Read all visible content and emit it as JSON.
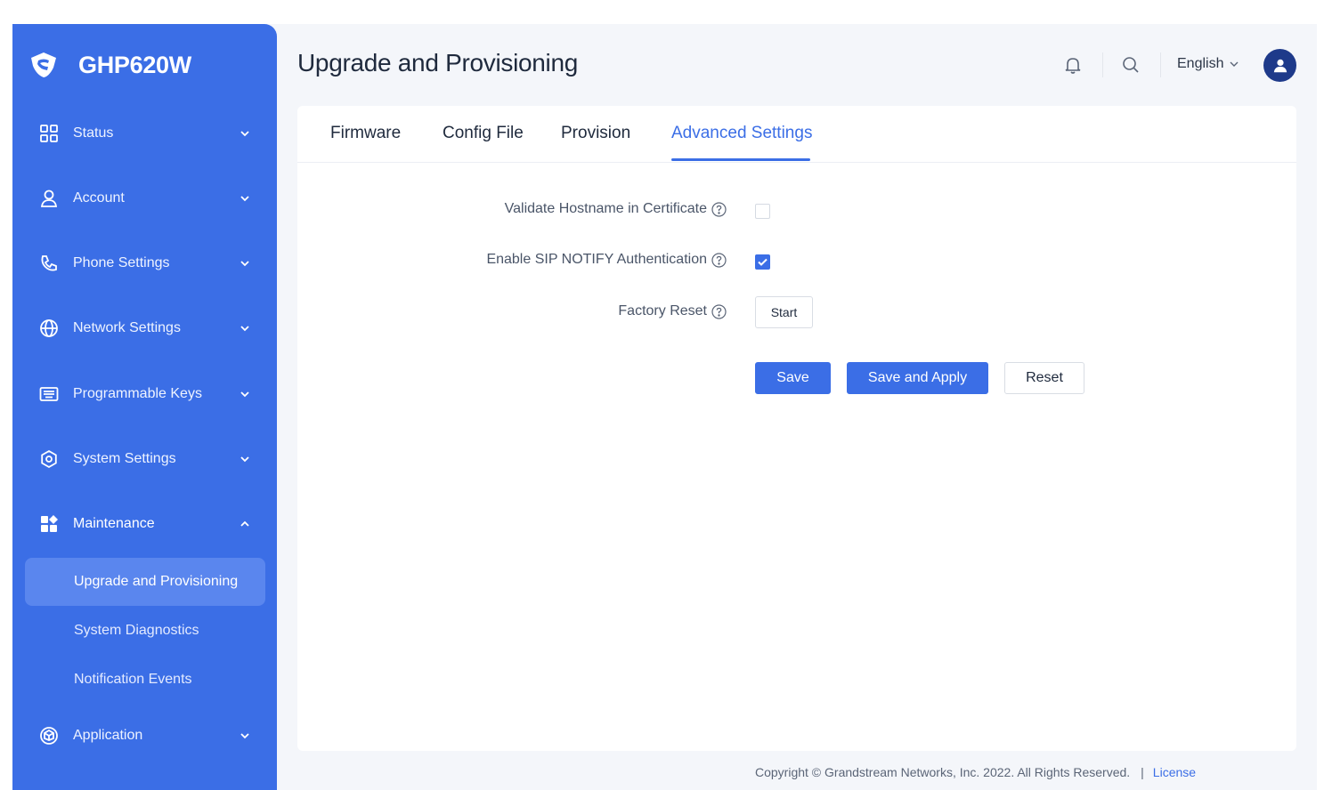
{
  "app": {
    "product_name": "GHP620W"
  },
  "colors": {
    "accent": "#3b6ee6",
    "sidebar": "#3b6ee6",
    "active_sub": "#5a86ee",
    "avatar": "#1e3a8a"
  },
  "sidebar": {
    "items": [
      {
        "label": "Status",
        "icon": "status-grid-icon",
        "expanded": false
      },
      {
        "label": "Account",
        "icon": "user-icon",
        "expanded": false
      },
      {
        "label": "Phone Settings",
        "icon": "phone-icon",
        "expanded": false
      },
      {
        "label": "Network Settings",
        "icon": "globe-icon",
        "expanded": false
      },
      {
        "label": "Programmable Keys",
        "icon": "keyboard-icon",
        "expanded": false
      },
      {
        "label": "System Settings",
        "icon": "gear-icon",
        "expanded": false
      },
      {
        "label": "Maintenance",
        "icon": "maintenance-icon",
        "expanded": true
      },
      {
        "label": "Application",
        "icon": "cube-icon",
        "expanded": false
      }
    ],
    "maintenance_sub": [
      {
        "label": "Upgrade and Provisioning",
        "active": true
      },
      {
        "label": "System Diagnostics",
        "active": false
      },
      {
        "label": "Notification Events",
        "active": false
      }
    ]
  },
  "header": {
    "title": "Upgrade and Provisioning",
    "language": "English"
  },
  "tabs": [
    {
      "label": "Firmware",
      "active": false
    },
    {
      "label": "Config File",
      "active": false
    },
    {
      "label": "Provision",
      "active": false
    },
    {
      "label": "Advanced Settings",
      "active": true
    }
  ],
  "form": {
    "validate_hostname": {
      "label": "Validate Hostname in Certificate",
      "checked": false
    },
    "sip_notify_auth": {
      "label": "Enable SIP NOTIFY Authentication",
      "checked": true
    },
    "factory_reset": {
      "label": "Factory Reset",
      "button": "Start"
    }
  },
  "actions": {
    "save": "Save",
    "save_apply": "Save and Apply",
    "reset": "Reset"
  },
  "footer": {
    "copyright": "Copyright © Grandstream Networks, Inc. 2022. All Rights Reserved.",
    "separator": "|",
    "license": "License"
  }
}
